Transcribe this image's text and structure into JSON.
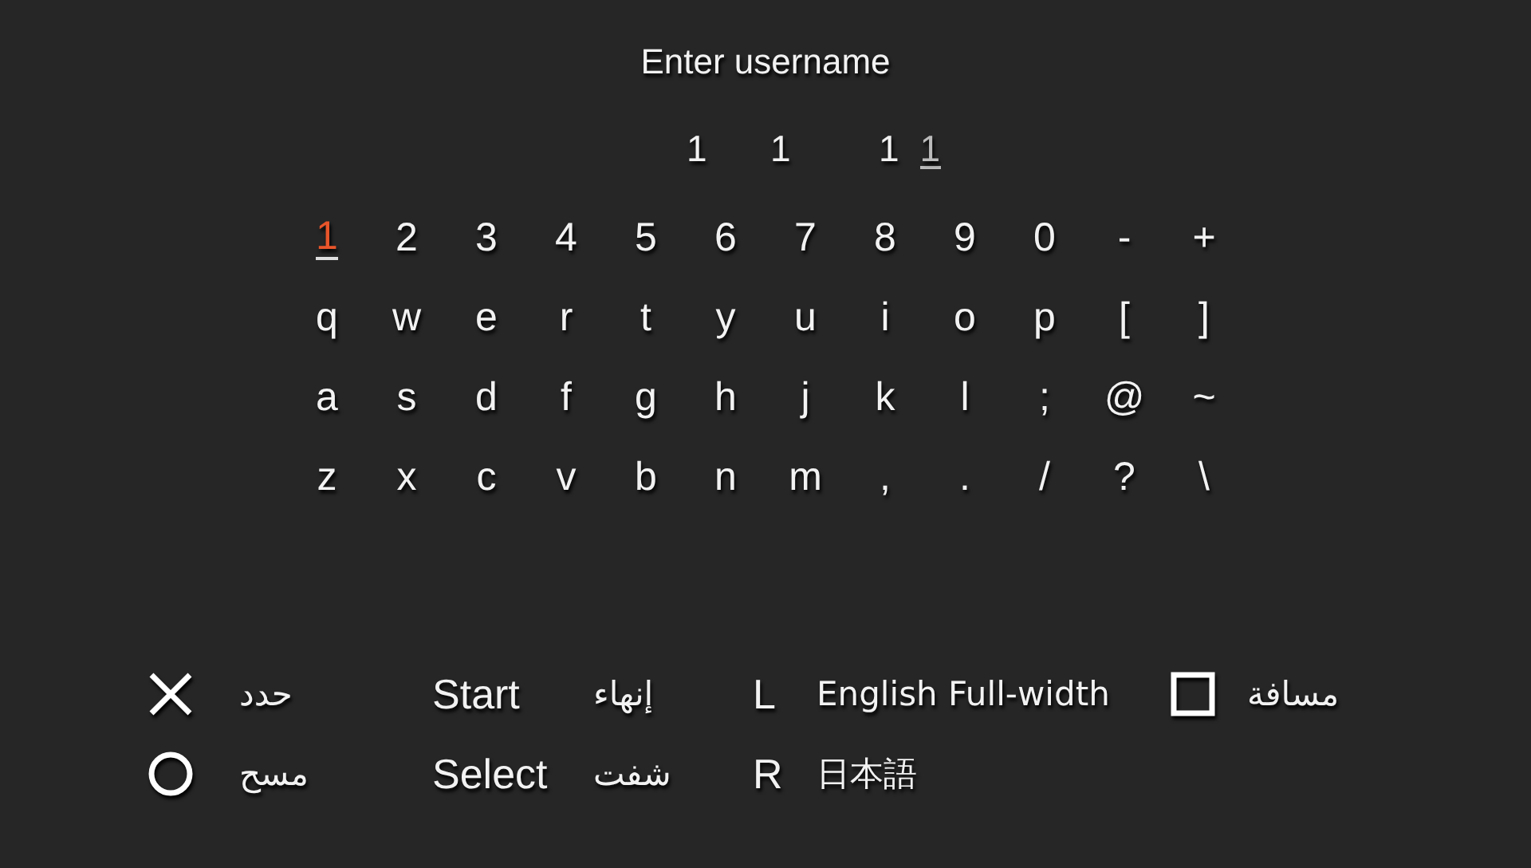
{
  "title": "Enter username",
  "input": {
    "value": "1  1   1",
    "cursor_char": "1"
  },
  "keyboard_rows": [
    {
      "keys": [
        {
          "label": "+",
          "selected": false
        },
        {
          "label": "-",
          "selected": false
        },
        {
          "label": "0",
          "selected": false
        },
        {
          "label": "9",
          "selected": false
        },
        {
          "label": "8",
          "selected": false
        },
        {
          "label": "7",
          "selected": false
        },
        {
          "label": "6",
          "selected": false
        },
        {
          "label": "5",
          "selected": false
        },
        {
          "label": "4",
          "selected": false
        },
        {
          "label": "3",
          "selected": false
        },
        {
          "label": "2",
          "selected": false
        },
        {
          "label": "1",
          "selected": true
        }
      ]
    },
    {
      "keys": [
        {
          "label": "]",
          "selected": false
        },
        {
          "label": "[",
          "selected": false
        },
        {
          "label": "p",
          "selected": false
        },
        {
          "label": "o",
          "selected": false
        },
        {
          "label": "i",
          "selected": false
        },
        {
          "label": "u",
          "selected": false
        },
        {
          "label": "y",
          "selected": false
        },
        {
          "label": "t",
          "selected": false
        },
        {
          "label": "r",
          "selected": false
        },
        {
          "label": "e",
          "selected": false
        },
        {
          "label": "w",
          "selected": false
        },
        {
          "label": "q",
          "selected": false
        }
      ]
    },
    {
      "keys": [
        {
          "label": "~",
          "selected": false
        },
        {
          "label": "@",
          "selected": false
        },
        {
          "label": ";",
          "selected": false
        },
        {
          "label": "l",
          "selected": false
        },
        {
          "label": "k",
          "selected": false
        },
        {
          "label": "j",
          "selected": false
        },
        {
          "label": "h",
          "selected": false
        },
        {
          "label": "g",
          "selected": false
        },
        {
          "label": "f",
          "selected": false
        },
        {
          "label": "d",
          "selected": false
        },
        {
          "label": "s",
          "selected": false
        },
        {
          "label": "a",
          "selected": false
        }
      ]
    },
    {
      "keys": [
        {
          "label": "\\",
          "selected": false
        },
        {
          "label": "?",
          "selected": false
        },
        {
          "label": "/",
          "selected": false
        },
        {
          "label": ".",
          "selected": false
        },
        {
          "label": ",",
          "selected": false
        },
        {
          "label": "m",
          "selected": false
        },
        {
          "label": "n",
          "selected": false
        },
        {
          "label": "b",
          "selected": false
        },
        {
          "label": "v",
          "selected": false
        },
        {
          "label": "c",
          "selected": false
        },
        {
          "label": "x",
          "selected": false
        },
        {
          "label": "z",
          "selected": false
        }
      ]
    }
  ],
  "legend_rows": [
    {
      "hints": [
        {
          "kind": "square",
          "action": "مسافة"
        },
        {
          "kind": "text",
          "button": "L",
          "action": "English Full-width"
        },
        {
          "kind": "text",
          "button": "Start",
          "action": "إنهاء"
        },
        {
          "kind": "cross",
          "action": "حدد"
        }
      ]
    },
    {
      "hints": [
        {
          "kind": "text",
          "button": "R",
          "action": "日本語"
        },
        {
          "kind": "text",
          "button": "Select",
          "action": "شفت"
        },
        {
          "kind": "circle",
          "action": "مسح"
        }
      ]
    }
  ]
}
